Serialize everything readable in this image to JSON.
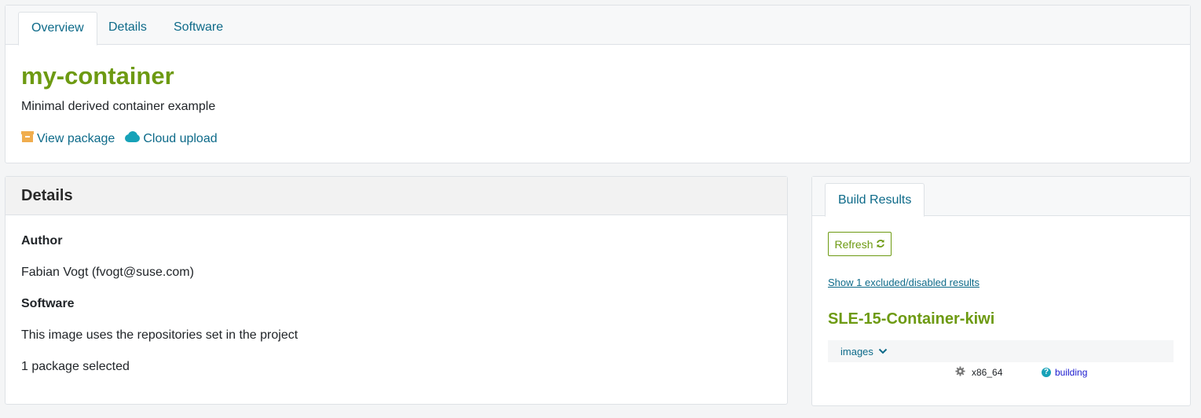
{
  "top": {
    "tabs": [
      {
        "label": "Overview",
        "active": true
      },
      {
        "label": "Details",
        "active": false
      },
      {
        "label": "Software",
        "active": false
      }
    ],
    "title": "my-container",
    "description": "Minimal derived container example",
    "links": {
      "view_package": "View package",
      "cloud_upload": "Cloud upload"
    }
  },
  "details": {
    "header": "Details",
    "author_label": "Author",
    "author_value": "Fabian Vogt (fvogt@suse.com)",
    "software_label": "Software",
    "software_value": "This image uses the repositories set in the project",
    "packages_selected": "1 package selected"
  },
  "build": {
    "tab": "Build Results",
    "refresh_label": "Refresh",
    "excluded_link": "Show 1 excluded/disabled results",
    "repository": "SLE-15-Container-kiwi",
    "repo_row_label": "images",
    "arch": "x86_64",
    "status": "building"
  },
  "colors": {
    "brand_green": "#6d9a12",
    "link_blue": "#0d6a89",
    "status_blue": "#1a1acf",
    "info_icon": "#17a2b8"
  },
  "icons": [
    "archive-icon",
    "cloud-icon",
    "refresh-icon",
    "chevron-down-icon",
    "gear-icon",
    "question-circle-icon"
  ]
}
